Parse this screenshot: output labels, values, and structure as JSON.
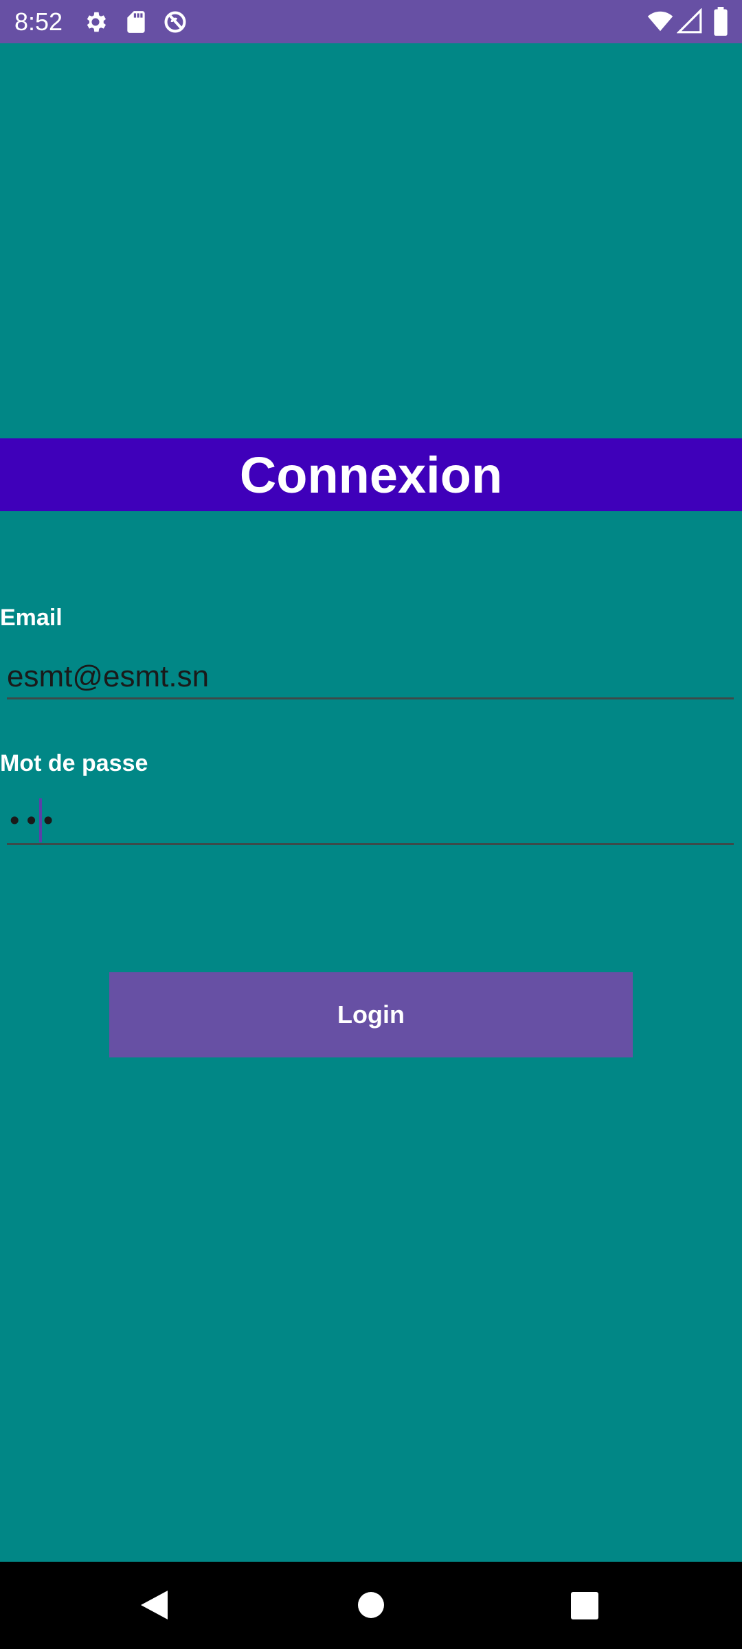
{
  "status_bar": {
    "time": "8:52",
    "icons": [
      "gear-icon",
      "sd-card-icon",
      "sync-off-icon",
      "wifi-icon",
      "cell-signal-icon",
      "battery-icon"
    ],
    "background": "#6750A4"
  },
  "header": {
    "title": "Connexion",
    "background": "#3F00BA"
  },
  "form": {
    "email_label": "Email",
    "email_value": "esmt@esmt.sn",
    "password_label": "Mot de passe",
    "password_mask": "•••",
    "login_label": "Login"
  },
  "colors": {
    "page_background": "#018786",
    "button_background": "#6750A4"
  },
  "nav_bar": {
    "icons": [
      "back-icon",
      "home-icon",
      "recents-icon"
    ]
  }
}
